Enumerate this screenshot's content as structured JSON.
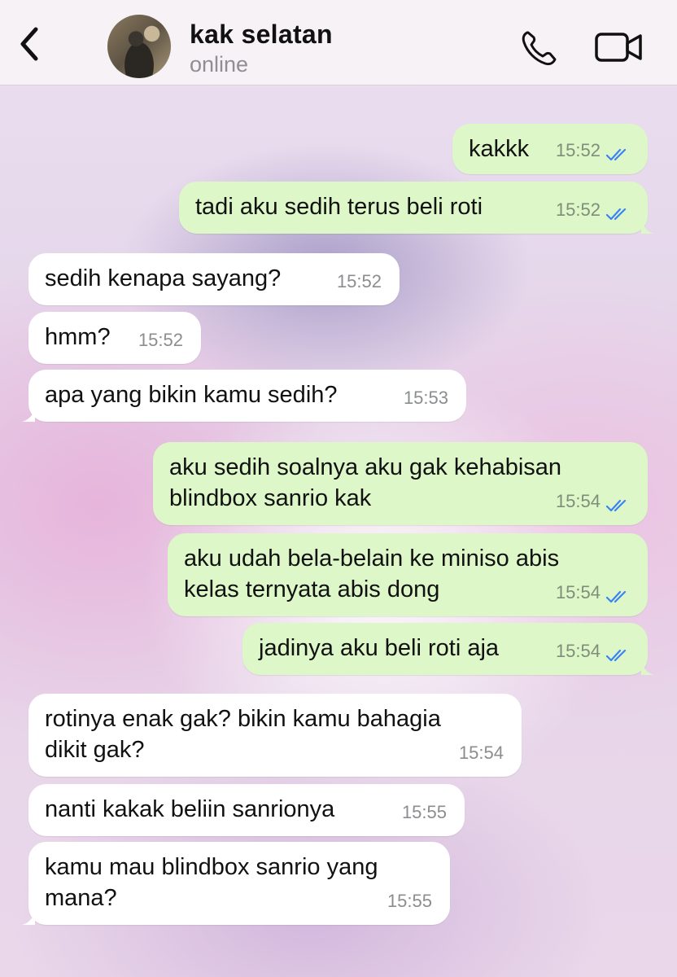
{
  "header": {
    "contact_name": "kak selatan",
    "status": "online",
    "icons": [
      "chevron-left-icon",
      "phone-icon",
      "video-camera-icon"
    ]
  },
  "colors": {
    "outgoing_bubble": "#ddf7c8",
    "incoming_bubble": "#ffffff",
    "read_tick": "#3b82f6"
  },
  "messages": [
    {
      "direction": "out",
      "lines": [
        "kakkk"
      ],
      "time": "15:52",
      "read": true
    },
    {
      "direction": "out",
      "lines": [
        "tadi aku sedih terus beli roti"
      ],
      "time": "15:52",
      "read": true
    },
    {
      "direction": "in",
      "lines": [
        "sedih kenapa sayang?"
      ],
      "time": "15:52"
    },
    {
      "direction": "in",
      "lines": [
        "hmm?"
      ],
      "time": "15:52"
    },
    {
      "direction": "in",
      "lines": [
        "apa yang bikin kamu sedih?"
      ],
      "time": "15:53"
    },
    {
      "direction": "out",
      "lines": [
        "aku sedih soalnya aku gak kehabisan",
        "blindbox sanrio kak"
      ],
      "time": "15:54",
      "read": true
    },
    {
      "direction": "out",
      "lines": [
        "aku udah bela-belain ke miniso abis",
        "kelas ternyata abis dong"
      ],
      "time": "15:54",
      "read": true
    },
    {
      "direction": "out",
      "lines": [
        "jadinya aku beli roti aja"
      ],
      "time": "15:54",
      "read": true
    },
    {
      "direction": "in",
      "lines": [
        "rotinya enak gak? bikin kamu bahagia",
        "dikit gak?"
      ],
      "time": "15:54"
    },
    {
      "direction": "in",
      "lines": [
        "nanti kakak beliin sanrionya"
      ],
      "time": "15:55"
    },
    {
      "direction": "in",
      "lines": [
        "kamu mau blindbox sanrio yang",
        "mana?"
      ],
      "time": "15:55"
    }
  ]
}
